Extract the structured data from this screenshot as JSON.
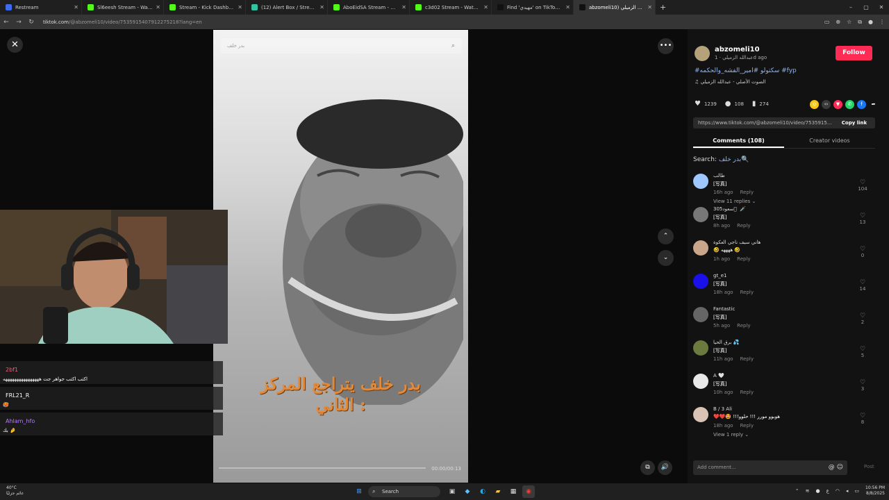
{
  "browser": {
    "tabs": [
      {
        "label": "Restream",
        "color": "#3d6cf0",
        "active": false
      },
      {
        "label": "Sl6eesh Stream - Watch Live o",
        "color": "#53fc18",
        "active": false
      },
      {
        "label": "Stream - Kick Dashboard",
        "color": "#53fc18",
        "active": false
      },
      {
        "label": "(12) Alert Box / Streamlabs",
        "color": "#31c3a2",
        "active": false
      },
      {
        "label": "AboEidSA Stream - Watch Live",
        "color": "#53fc18",
        "active": false
      },
      {
        "label": "c3d02 Stream - Watch Live on",
        "color": "#53fc18",
        "active": false
      },
      {
        "label": "Find 'ﻣﻬﻴﺪﻱ' on TikTok | TikTo",
        "color": "#111111",
        "active": false
      },
      {
        "label": "abzomeli10) عبدالله الزميلي",
        "color": "#111111",
        "active": true
      }
    ],
    "url_host": "tiktok.com",
    "url_path": "/@abzomeli10/video/7535915407912275218?lang=en",
    "window_controls": [
      "–",
      "▢",
      "✕"
    ]
  },
  "viewer": {
    "close_glyph": "✕",
    "more_glyph": "•••",
    "up_glyph": "⌃",
    "down_glyph": "⌄",
    "video": {
      "search_placeholder": "بدر خلف",
      "caption_line1": "بدر خلف يتراجع المركز",
      "caption_line2": "الثاني :",
      "time": "00:00/00:13"
    }
  },
  "stream_chat": [
    {
      "name": "2bf1",
      "name_color": "#ff5d7a",
      "message": "اكتب اكتب جواهر جت ههههههههههههههههه"
    },
    {
      "name": "FRL21_R",
      "name_color": "#ffffff",
      "message": "🥵"
    },
    {
      "name": "Ahlam_hfo",
      "name_color": "#b57cff",
      "message": "بك 🤌"
    }
  ],
  "panel": {
    "username": "abzomeli10",
    "subtitle": "عبدالله الزميلي · 1d ago",
    "follow_label": "Follow",
    "hashtags": "#سكتولو #امير_الفشه_والحكمه #fyp",
    "music": "الصوت الأصلي - عبدالله الزميلي",
    "likes": "1239",
    "comments_count": "108",
    "saves": "274",
    "link": "https://www.tiktok.com/@abzomeli10/video/7535915...",
    "copy_label": "Copy link",
    "tab_comments": "Comments (108)",
    "tab_creator": "Creator videos",
    "search_prefix": "Search:",
    "search_query": "بدر خلف",
    "comment_input_placeholder": "Add comment...",
    "post_label": "Post",
    "comments": [
      {
        "name": "ﻃﺎﻟﺐ",
        "text": "[写真]",
        "time": "16h ago",
        "likes": "104",
        "replies": "View 11 replies ⌄",
        "avatar_color": "#9ec7ff"
      },
      {
        "name": "305ﺳﻌﻮﺩ 🏽 🗡️",
        "text": "[写真]",
        "time": "8h ago",
        "likes": "13",
        "replies": "",
        "avatar_color": "#777777"
      },
      {
        "name": "ﻫﺎﻧﻲ ﺳﻴﻒ ﻧﺎﺟﻲ ﺍﻟﻌﻜﻮﺓ",
        "text": "🤣 ههههه 🤣",
        "time": "1h ago",
        "likes": "0",
        "replies": "",
        "avatar_color": "#c9a58a"
      },
      {
        "name": "gt_e1",
        "text": "[写真]",
        "time": "18h ago",
        "likes": "14",
        "replies": "",
        "avatar_color": "#1a10e8"
      },
      {
        "name": "Fantastic",
        "text": "[写真]",
        "time": "5h ago",
        "likes": "2",
        "replies": "",
        "avatar_color": "#666666"
      },
      {
        "name": "ﺑﺮﻕ ﺍﻟﺤﻴﺎ 💦",
        "text": "[写真]",
        "time": "11h ago",
        "likes": "5",
        "replies": "",
        "avatar_color": "#6b7a3e"
      },
      {
        "name": "A 🤍",
        "text": "[写真]",
        "time": "10h ago",
        "likes": "3",
        "replies": "",
        "avatar_color": "#e8e8e8"
      },
      {
        "name": "B / 3 Ali",
        "text": "❤️❤️🤩 !!!هوبوو مورر !!! حلوو",
        "time": "18h ago",
        "likes": "8",
        "replies": "View 1 reply ⌄",
        "avatar_color": "#d9c3b5"
      }
    ]
  },
  "taskbar": {
    "temp": "40°C",
    "weather_text": "غائم جزئيًا",
    "search_label": "Search",
    "time": "10:56 PM",
    "date": "8/8/2025",
    "lang": "ع"
  }
}
